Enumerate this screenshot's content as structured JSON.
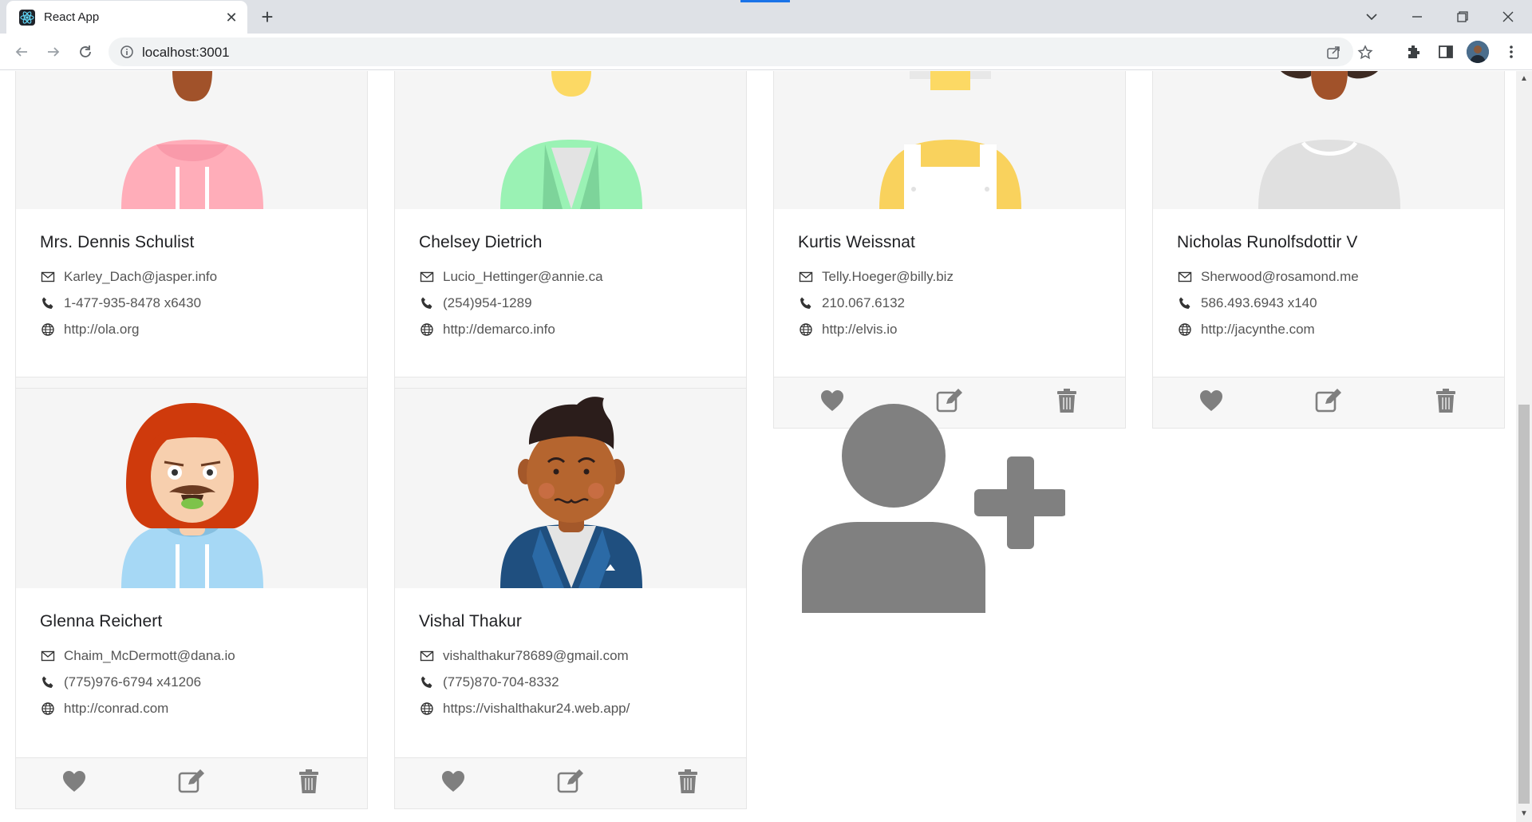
{
  "browser": {
    "tab_title": "React App",
    "url": "localhost:3001"
  },
  "cards": [
    {
      "name": "Mrs. Dennis Schulist",
      "email": "Karley_Dach@jasper.info",
      "phone": "1-477-935-8478 x6430",
      "website": "http://ola.org",
      "avatar": "woman-pink-hoodie"
    },
    {
      "name": "Chelsey Dietrich",
      "email": "Lucio_Hettinger@annie.ca",
      "phone": "(254)954-1289",
      "website": "http://demarco.info",
      "avatar": "person-green-jacket"
    },
    {
      "name": "Kurtis Weissnat",
      "email": "Telly.Hoeger@billy.biz",
      "phone": "210.067.6132",
      "website": "http://elvis.io",
      "avatar": "person-yellow-overalls"
    },
    {
      "name": "Nicholas Runolfsdottir V",
      "email": "Sherwood@rosamond.me",
      "phone": "586.493.6943 x140",
      "website": "http://jacynthe.com",
      "avatar": "man-grey-sweater"
    },
    {
      "name": "Glenna Reichert",
      "email": "Chaim_McDermott@dana.io",
      "phone": "(775)976-6794 x41206",
      "website": "http://conrad.com",
      "avatar": "redhead-mustache"
    },
    {
      "name": "Vishal Thakur",
      "email": "vishalthakur78689@gmail.com",
      "phone": "(775)870-704-8332",
      "website": "https://vishalthakur24.web.app/",
      "avatar": "man-blue-blazer"
    }
  ],
  "icons": {
    "email": "envelope-icon",
    "phone": "phone-icon",
    "website": "globe-icon",
    "like": "heart-icon",
    "edit": "edit-icon",
    "delete": "trash-icon",
    "add": "add-user-icon"
  },
  "colors": {
    "action_icon": "#7f7f7f",
    "card_border": "#e6e6e6",
    "footer_bg": "#f7f7f7"
  }
}
